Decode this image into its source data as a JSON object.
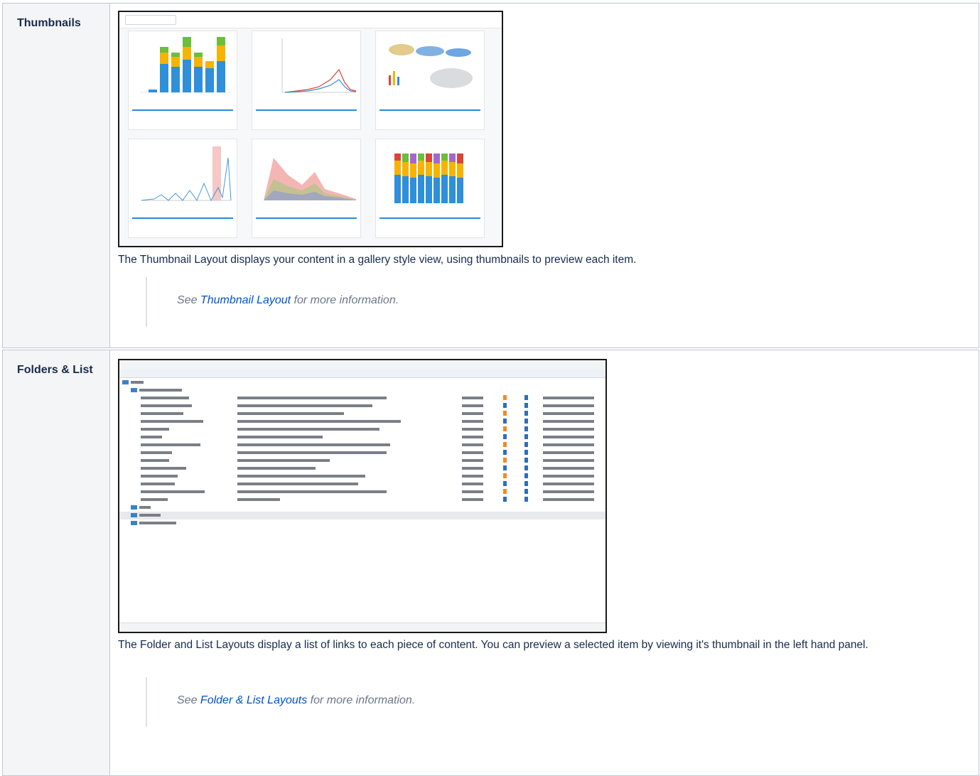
{
  "rows": [
    {
      "heading": "Thumbnails",
      "description": "The Thumbnail Layout displays your content in a gallery style view, using thumbnails to preview each item.",
      "see_prefix": "See ",
      "see_link": "Thumbnail Layout",
      "see_suffix": " for more information."
    },
    {
      "heading": "Folders & List",
      "description": "The Folder and List Layouts display a list of links to each piece of content. You can preview a selected item by viewing it's thumbnail in the left hand panel.",
      "see_prefix": "See ",
      "see_link": "Folder & List Layouts",
      "see_suffix": " for more information."
    }
  ],
  "thumbnail_cards": [
    {
      "title": "",
      "icon": "bar-chart-icon"
    },
    {
      "title": "",
      "icon": "line-chart-icon"
    },
    {
      "title": "",
      "icon": "map-icon"
    },
    {
      "title": "",
      "icon": "line-chart-icon"
    },
    {
      "title": "",
      "icon": "area-chart-icon"
    },
    {
      "title": "",
      "icon": "bar-chart-icon"
    }
  ],
  "colors": {
    "link": "#0052cc",
    "border": "#c1c7d0",
    "header_bg": "#f4f5f7",
    "accent_blue": "#2a8bd6"
  }
}
